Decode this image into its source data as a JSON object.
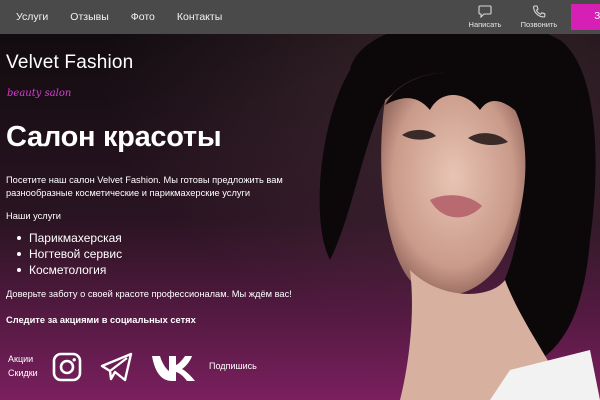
{
  "nav": {
    "items": [
      "Услуги",
      "Отзывы",
      "Фото",
      "Контакты"
    ]
  },
  "actions": {
    "message_label": "Написать",
    "call_label": "Позвонить",
    "cta_label": "За"
  },
  "brand": {
    "name": "Velvet Fashion",
    "tagline": "beauty salon"
  },
  "hero": {
    "title": "Салон красоты",
    "intro": "Посетите наш салон Velvet Fashion. Мы готовы предложить вам разнообразные косметические и парикмахерские услуги",
    "services_label": "Наши услуги",
    "services": [
      "Парикмахерская",
      "Ногтевой сервис",
      "Косметология"
    ],
    "trust_text": "Доверьте заботу о своей красоте профессионалам. Мы ждём вас!",
    "follow_text": "Следите за акциями в социальных сетях"
  },
  "social": {
    "promo_line1": "Акции",
    "promo_line2": "Скидки",
    "subscribe_label": "Подпишись",
    "icons": [
      "instagram-icon",
      "telegram-icon",
      "vk-icon"
    ]
  },
  "colors": {
    "accent": "#d61fb4",
    "tagline": "#d33fd0",
    "topbar": "#4a4a4a",
    "gradient_bottom": "#7a1f5e"
  }
}
